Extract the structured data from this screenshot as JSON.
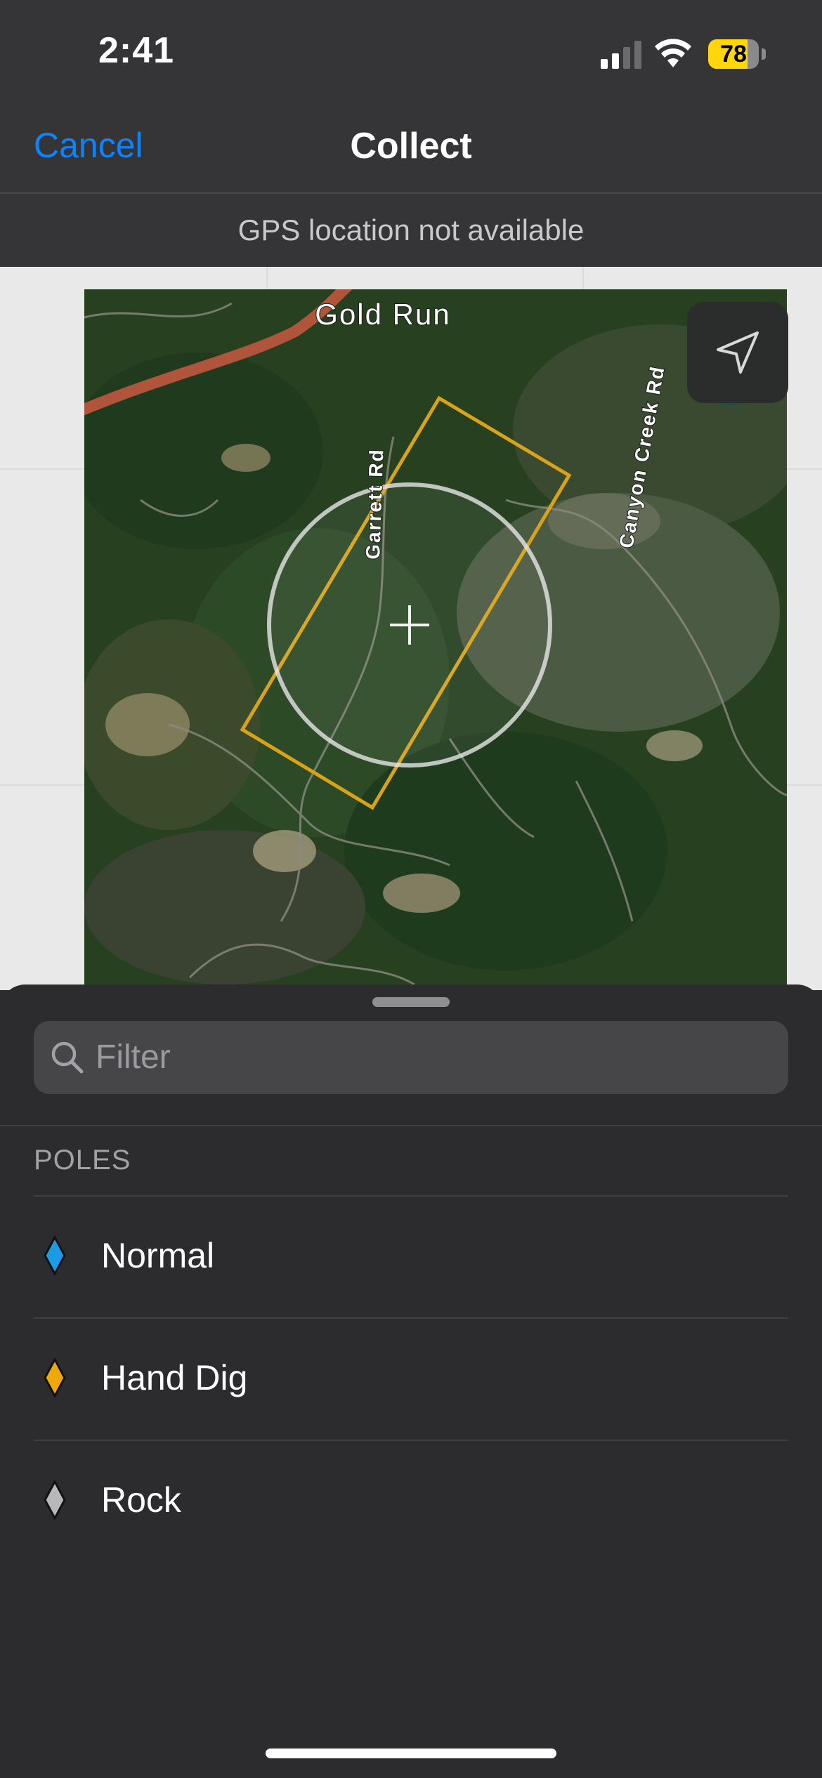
{
  "status_bar": {
    "time": "2:41",
    "battery": "78",
    "battery_level": 0.78,
    "icons": [
      "cellular-signal-icon",
      "wifi-icon",
      "battery-icon"
    ]
  },
  "nav": {
    "cancel_label": "Cancel",
    "title": "Collect"
  },
  "gps_notice": "GPS location not available",
  "map": {
    "labels": {
      "place": "Gold Run",
      "road_1": "Garrett Rd",
      "road_2": "Canyon Creek Rd"
    },
    "icons": [
      "crosshair-icon",
      "location-arrow-icon"
    ]
  },
  "sheet": {
    "filter_placeholder": "Filter",
    "section_title": "POLES",
    "items": [
      {
        "label": "Normal",
        "color": "#1a9be6"
      },
      {
        "label": "Hand Dig",
        "color": "#f0a70a"
      },
      {
        "label": "Rock",
        "color": "#b8b8bc"
      }
    ]
  },
  "colors": {
    "accent": "#0a84ff",
    "polygon": "#d8a31b"
  }
}
